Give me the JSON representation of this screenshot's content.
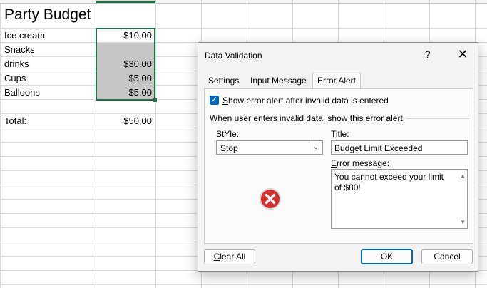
{
  "sheet": {
    "title": "Party Budget",
    "rows": [
      {
        "label": "Ice cream",
        "value": "$10,00"
      },
      {
        "label": "Snacks",
        "value": ""
      },
      {
        "label": "drinks",
        "value": "$30,00"
      },
      {
        "label": "Cups",
        "value": "$5,00"
      },
      {
        "label": "Balloons",
        "value": "$5,00"
      }
    ],
    "total_label": "Total:",
    "total_value": "$50,00"
  },
  "dialog": {
    "title": "Data Validation",
    "help": "?",
    "close": "✕",
    "tabs": [
      "Settings",
      "Input Message",
      "Error Alert"
    ],
    "active_tab": "Error Alert",
    "show_alert_checkbox": {
      "checked": true,
      "label_first": "S",
      "label_rest": "how error alert after invalid data is entered"
    },
    "section_label": "When user enters invalid data, show this error alert:",
    "style_label_first": "Y",
    "style_label_rest": "",
    "style_label_pre": "St",
    "style_label_post": "le:",
    "style_value": "Stop",
    "title_label_first": "T",
    "title_label_rest": "itle:",
    "title_value": "Budget Limit Exceeded",
    "message_label_first": "E",
    "message_label_rest": "rror message:",
    "message_value": "You cannot exceed your limit of $80!",
    "buttons": {
      "clear_first": "C",
      "clear_rest": "lear All",
      "ok": "OK",
      "cancel": "Cancel"
    },
    "icon": "error-stop-icon"
  }
}
